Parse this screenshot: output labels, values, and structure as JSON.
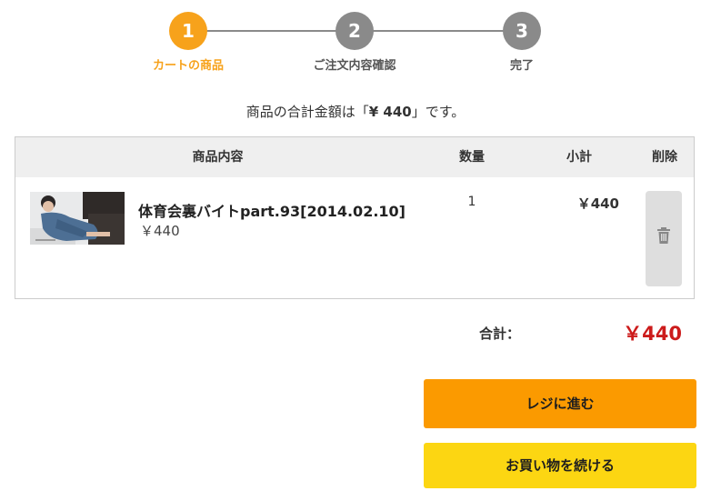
{
  "steps": [
    {
      "number": "1",
      "label": "カートの商品",
      "active": true
    },
    {
      "number": "2",
      "label": "ご注文内容確認",
      "active": false
    },
    {
      "number": "3",
      "label": "完了",
      "active": false
    }
  ],
  "summary": {
    "prefix": "商品の合計金額は「",
    "amount": "¥ 440",
    "suffix": "」です。"
  },
  "table": {
    "headers": {
      "product": "商品内容",
      "quantity": "数量",
      "subtotal": "小計",
      "delete": "削除"
    },
    "items": [
      {
        "title": "体育会裏バイトpart.93[2014.02.10]",
        "price": "￥440",
        "quantity": "1",
        "subtotal": "￥440",
        "thumbnail_icon": "product-thumbnail",
        "delete_icon": "trash-icon"
      }
    ]
  },
  "total": {
    "label": "合計：",
    "value": "￥440"
  },
  "buttons": {
    "checkout": "レジに進む",
    "continue_shopping": "お買い物を続ける"
  },
  "colors": {
    "accent": "#f7a21b",
    "inactive_step": "#8a8a8a",
    "total_price": "#cc1b1b",
    "checkout_button": "#fb9a00",
    "continue_button": "#fcd612"
  }
}
